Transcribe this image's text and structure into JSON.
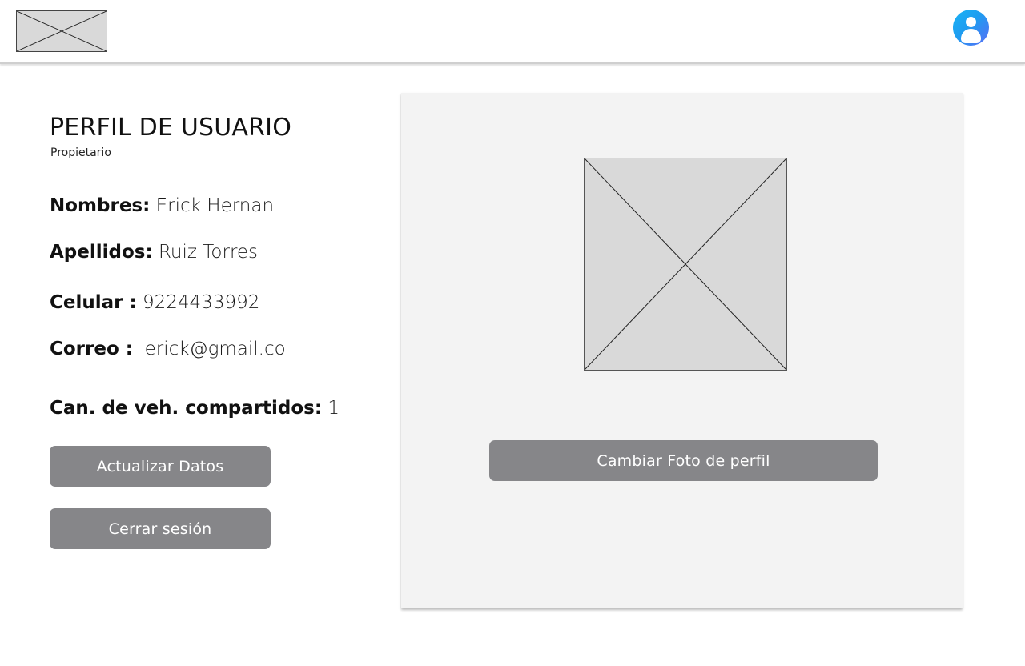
{
  "header": {
    "logo_icon": "image-placeholder-icon",
    "avatar_icon": "user-avatar-icon",
    "avatar_gradient": [
      "#19b4f5",
      "#5a6cf6"
    ]
  },
  "profile": {
    "title": "PERFIL DE USUARIO",
    "role": "Propietario",
    "fields": [
      {
        "label": "Nombres:",
        "value": "Erick Hernan"
      },
      {
        "label": "Apellidos:",
        "value": "Ruiz Torres"
      },
      {
        "label": "Celular :",
        "value": "9224433992"
      },
      {
        "label": "Correo :",
        "value": " erick@gmail.co"
      },
      {
        "label": "Can. de veh. compartidos:",
        "value": "1"
      }
    ],
    "update_button": "Actualizar Datos",
    "logout_button": "Cerrar sesión"
  },
  "photo_panel": {
    "photo_icon": "image-placeholder-icon",
    "change_photo_button": "Cambiar Foto de perfil"
  },
  "colors": {
    "button_bg": "#868689",
    "panel_bg": "#f3f3f3",
    "placeholder_bg": "#d9d9d9"
  }
}
